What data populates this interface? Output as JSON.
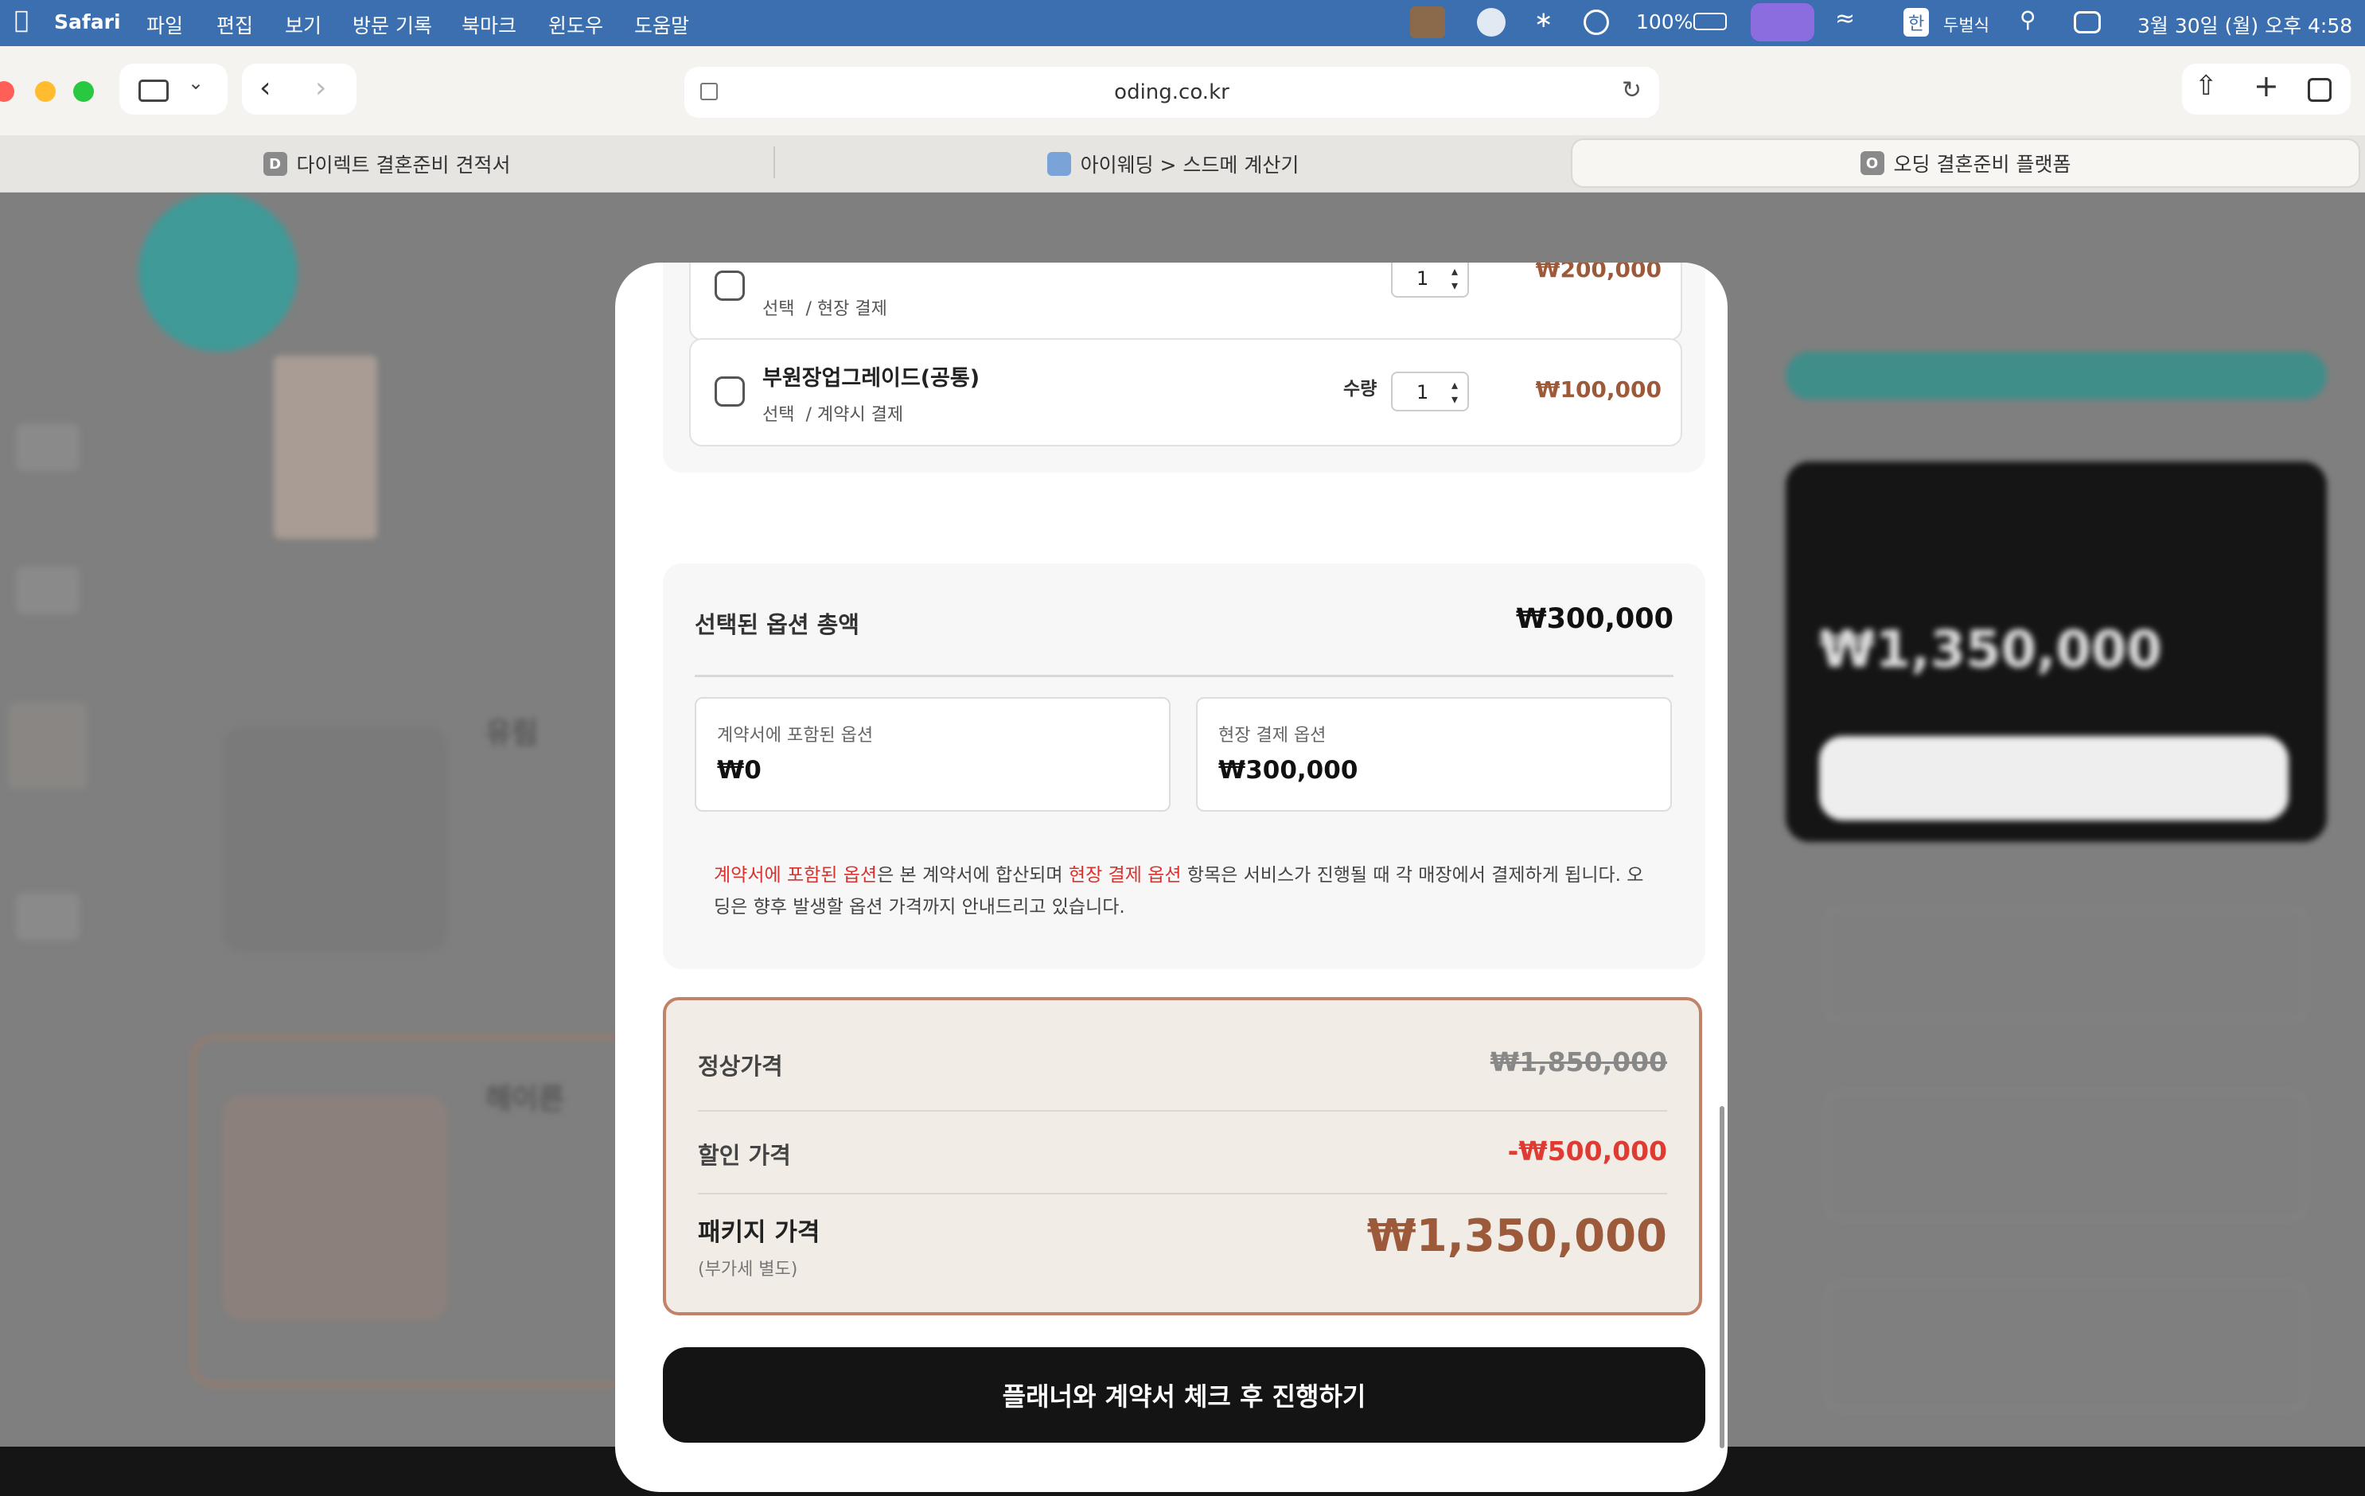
{
  "menubar": {
    "app": "Safari",
    "items": [
      "파일",
      "편집",
      "보기",
      "방문 기록",
      "북마크",
      "윈도우",
      "도움말"
    ],
    "battery": "100%",
    "input_method_badge": "한",
    "input_method": "두벌식",
    "datetime": "3월 30일 (월) 오후 4:58"
  },
  "browser": {
    "url": "oding.co.kr",
    "tabs": [
      {
        "icon": "D",
        "label": "다이렉트 결혼준비 견적서"
      },
      {
        "icon": "",
        "label": "아이웨딩 > 스드메 계산기"
      },
      {
        "icon": "O",
        "label": "오딩 결혼준비 플랫폼"
      }
    ]
  },
  "modal": {
    "options": [
      {
        "name": "",
        "sub_type": "선택",
        "sub_pay": "/ 현장 결제",
        "qty": "1",
        "price": "₩200,000"
      },
      {
        "name": "부원장업그레이드(공통)",
        "sub_type": "선택",
        "sub_pay": "/ 계약시 결제",
        "qty_label": "수량",
        "qty": "1",
        "price": "₩100,000"
      }
    ],
    "summary": {
      "title": "선택된 옵션 총액",
      "total": "₩300,000",
      "contract_label": "계약서에 포함된 옵션",
      "contract_value": "₩0",
      "onsite_label": "현장 결제 옵션",
      "onsite_value": "₩300,000",
      "note_part1": "계약서에 포함된 옵션",
      "note_part2": "은 본 계약서에 합산되며 ",
      "note_part3": "현장 결제 옵션",
      "note_part4": " 항목은 서비스가 진행될 때 각 매장에서 결제하게 됩니다. 오딩은 향후 발생할 옵션 가격까지 안내드리고 있습니다."
    },
    "pricing": {
      "regular_label": "정상가격",
      "regular_value": "₩1,850,000",
      "discount_label": "할인 가격",
      "discount_value": "-₩500,000",
      "package_label": "패키지 가격",
      "package_note": "(부가세 별도)",
      "package_value": "₩1,350,000"
    },
    "cta": "플래너와 계약서 체크 후 진행하기"
  },
  "background": {
    "sidebar_price": "₩1,350,000",
    "items": [
      "유림",
      "해이른"
    ]
  },
  "colors": {
    "accent_red": "#d8322e",
    "price_brown": "#9c5a3a",
    "border_brown": "#c0836a",
    "menubar": "#3b6fb0"
  }
}
